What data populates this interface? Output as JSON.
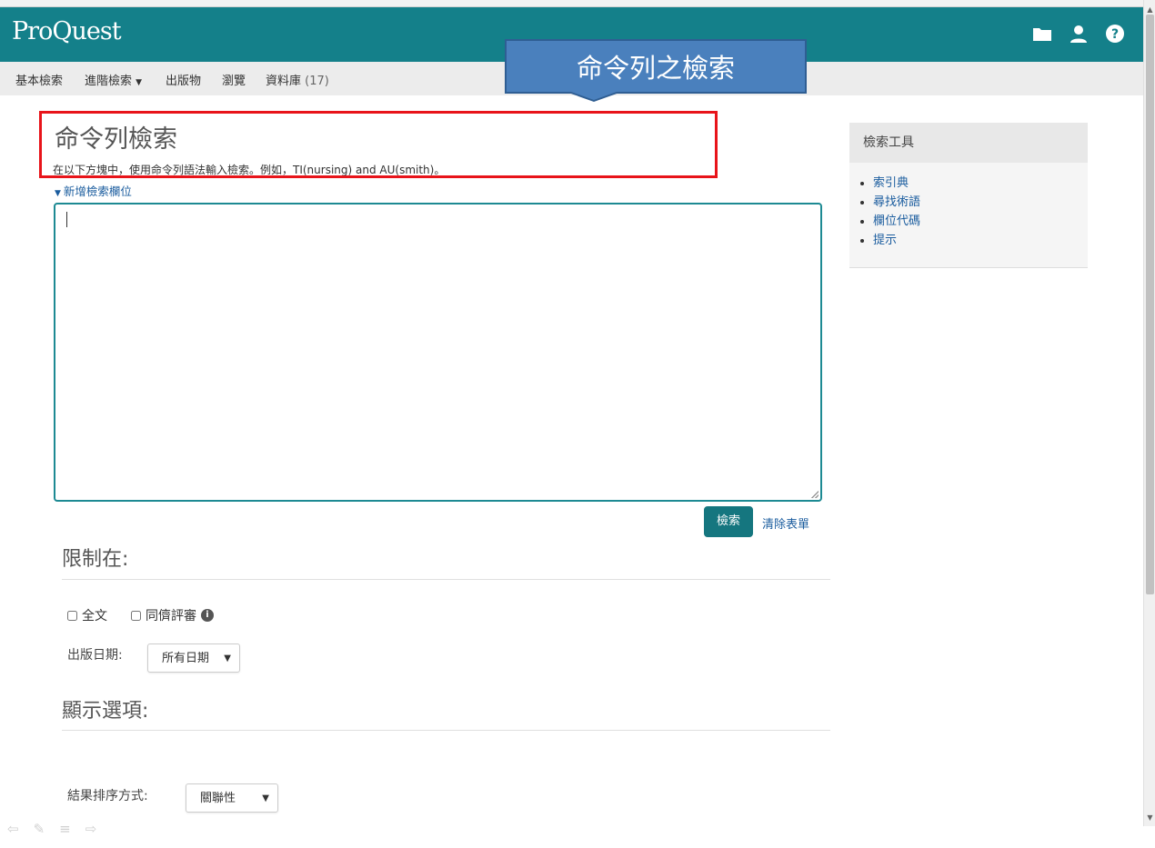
{
  "header": {
    "logo": "ProQuest",
    "icons": [
      "folder-icon",
      "user-icon",
      "help-icon"
    ],
    "color": "#14808a"
  },
  "nav": {
    "basic_search": "基本檢索",
    "advanced_search": "進階檢索",
    "publications": "出版物",
    "browse": "瀏覽",
    "databases": "資料庫",
    "databases_count": "(17)"
  },
  "callout": {
    "text": "命令列之檢索"
  },
  "main": {
    "title": "命令列檢索",
    "instruction": "在以下方塊中，使用命令列語法輸入檢索。例如，TI(nursing) and AU(smith)。",
    "add_field": "新增檢索欄位",
    "command_value": "",
    "search_button": "檢索",
    "clear_form": "清除表單"
  },
  "limits": {
    "title": "限制在:",
    "full_text": "全文",
    "peer_reviewed": "同儕評審",
    "pub_date_label": "出版日期:",
    "pub_date_value": "所有日期"
  },
  "display": {
    "title": "顯示選項:",
    "sort_label": "結果排序方式:",
    "sort_value": "關聯性"
  },
  "sidebar": {
    "title": "檢索工具",
    "items": [
      "索引典",
      "尋找術語",
      "欄位代碼",
      "提示"
    ]
  }
}
